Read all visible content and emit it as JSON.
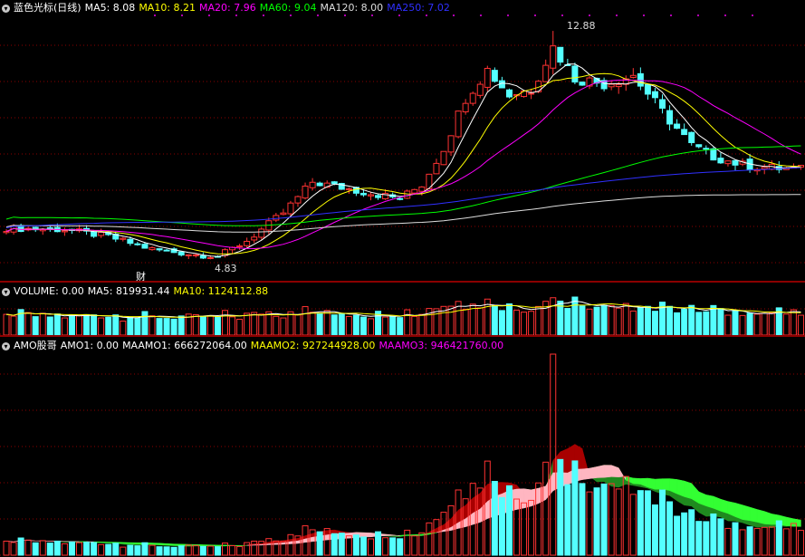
{
  "price_panel": {
    "title": "蓝色光标(日线)",
    "indicators": [
      {
        "label": "MA5: 8.08",
        "color": "#ffffff"
      },
      {
        "label": "MA10: 8.21",
        "color": "#ffff00"
      },
      {
        "label": "MA20: 7.96",
        "color": "#ff00ff"
      },
      {
        "label": "MA60: 9.04",
        "color": "#00ff00"
      },
      {
        "label": "MA120: 8.00",
        "color": "#dddddd"
      },
      {
        "label": "MA250: 7.02",
        "color": "#3030ff"
      }
    ],
    "high_label": "12.88",
    "low_label": "4.83",
    "event_marker": "财"
  },
  "volume_panel": {
    "labels": [
      {
        "label": "VOLUME: 0.00",
        "color": "#ffffff"
      },
      {
        "label": "MA5: 819931.44",
        "color": "#ffffff"
      },
      {
        "label": "MA10: 1124112.88",
        "color": "#ffff00"
      }
    ]
  },
  "amo_panel": {
    "labels": [
      {
        "label": "AMO股哥",
        "color": "#ffffff"
      },
      {
        "label": "AMO1: 0.00",
        "color": "#ffffff"
      },
      {
        "label": "MAAMO1: 666272064.00",
        "color": "#ffffff"
      },
      {
        "label": "MAAMO2: 927244928.00",
        "color": "#ffff00"
      },
      {
        "label": "MAAMO3: 946421760.00",
        "color": "#ff00ff"
      }
    ]
  },
  "colors": {
    "up": "#ff3232",
    "down": "#54ffff",
    "grid": "#8b0000",
    "fill_red": "#a80000",
    "fill_pink": "#ffb6c1",
    "fill_green": "#33ff33",
    "fill_darkgreen": "#1f8a1f"
  }
}
